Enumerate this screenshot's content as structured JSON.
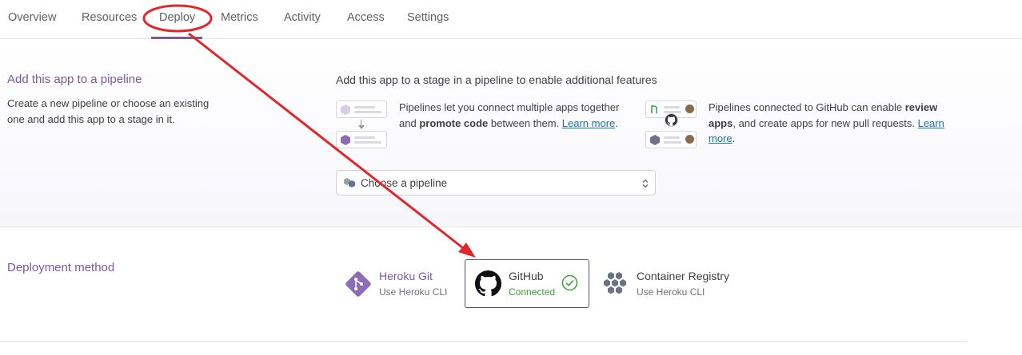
{
  "tabs": [
    {
      "label": "Overview"
    },
    {
      "label": "Resources"
    },
    {
      "label": "Deploy"
    },
    {
      "label": "Metrics"
    },
    {
      "label": "Activity"
    },
    {
      "label": "Access"
    },
    {
      "label": "Settings"
    }
  ],
  "active_tab": "Deploy",
  "pipeline": {
    "title": "Add this app to a pipeline",
    "description": "Create a new pipeline or choose an existing one and add this app to a stage in it.",
    "intro": "Add this app to a stage in a pipeline to enable additional features",
    "feature1": {
      "text_a": "Pipelines let you connect multiple apps together and ",
      "bold": "promote code",
      "text_b": " between them. ",
      "link": "Learn more",
      "end": "."
    },
    "feature2": {
      "text_a": "Pipelines connected to GitHub can enable ",
      "bold": "review apps",
      "text_b": ", and create apps for new pull requests. ",
      "link": "Learn more",
      "end": "."
    },
    "select_label": "Choose a pipeline"
  },
  "deployment": {
    "title": "Deployment method",
    "methods": [
      {
        "title": "Heroku Git",
        "subtitle": "Use Heroku CLI",
        "selected": false
      },
      {
        "title": "GitHub",
        "subtitle": "Connected",
        "selected": true
      },
      {
        "title": "Container Registry",
        "subtitle": "Use Heroku CLI",
        "selected": false
      }
    ]
  },
  "colors": {
    "brand_purple": "#79589f",
    "connected_green": "#3e9b3e",
    "link_blue": "#1a73a8",
    "annotation_red": "#e0282a"
  },
  "icons": [
    "pipeline-icon",
    "chevron-updown-icon",
    "heroku-git-icon",
    "github-icon",
    "check-circle-icon",
    "container-registry-icon"
  ]
}
